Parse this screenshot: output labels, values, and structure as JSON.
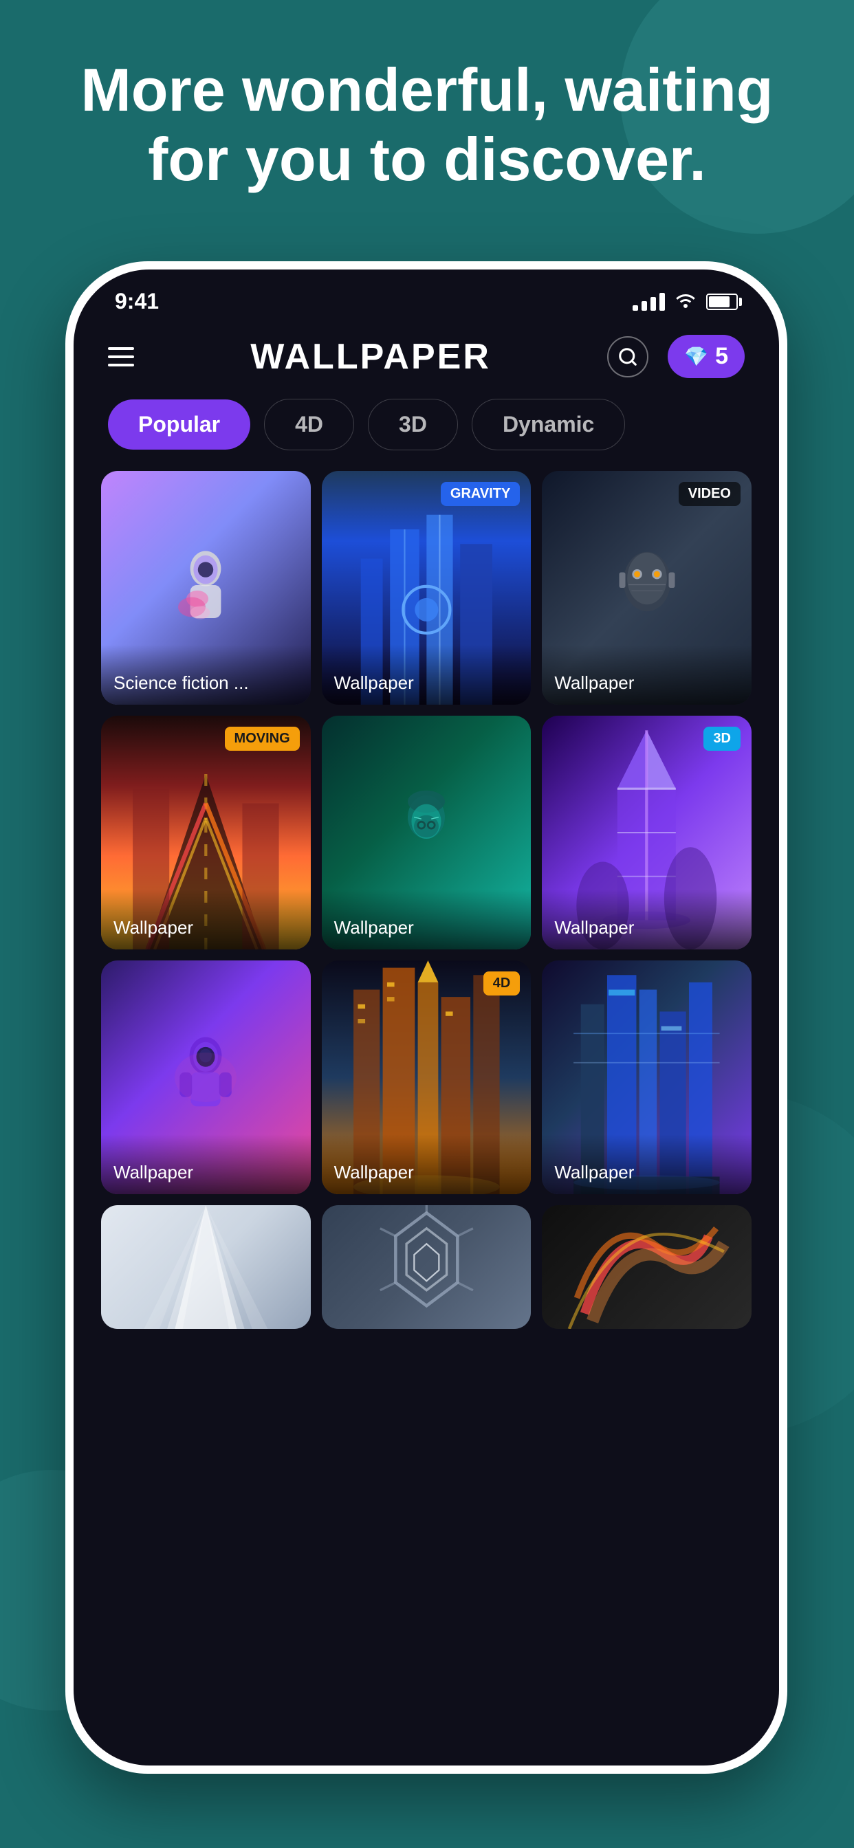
{
  "background": {
    "color": "#1a6b6b"
  },
  "hero": {
    "text": "More wonderful, waiting for you to discover."
  },
  "statusBar": {
    "time": "9:41",
    "signalBars": [
      6,
      10,
      14,
      18
    ],
    "battery": "80"
  },
  "appHeader": {
    "title": "WALLPAPER",
    "searchAriaLabel": "Search",
    "gems": {
      "count": "5",
      "icon": "💎"
    }
  },
  "categories": [
    {
      "label": "Popular",
      "active": true
    },
    {
      "label": "4D",
      "active": false
    },
    {
      "label": "3D",
      "active": false
    },
    {
      "label": "Dynamic",
      "active": false
    }
  ],
  "wallpapers": [
    {
      "label": "Science fiction ...",
      "badge": null,
      "colorClass": "wp-1",
      "hasAstronaut": true
    },
    {
      "label": "Wallpaper",
      "badge": "GRAVITY",
      "badgeClass": "badge-gravity",
      "colorClass": "wp-2"
    },
    {
      "label": "Wallpaper",
      "badge": "VIDEO",
      "badgeClass": "badge-video",
      "colorClass": "wp-3"
    },
    {
      "label": "Wallpaper",
      "badge": "MOVING",
      "badgeClass": "badge-moving",
      "colorClass": "wp-4"
    },
    {
      "label": "Wallpaper",
      "badge": null,
      "colorClass": "wp-5"
    },
    {
      "label": "Wallpaper",
      "badge": "3D",
      "badgeClass": "badge-3d",
      "colorClass": "wp-6"
    },
    {
      "label": "Wallpaper",
      "badge": null,
      "colorClass": "wp-7"
    },
    {
      "label": "Wallpaper",
      "badge": "4D",
      "badgeClass": "badge-4d",
      "colorClass": "wp-8"
    },
    {
      "label": "Wallpaper",
      "badge": null,
      "colorClass": "wp-9"
    }
  ],
  "partialWallpapers": [
    {
      "colorClass": "wp-10",
      "badge": null
    },
    {
      "colorClass": "wp-1",
      "badge": null
    },
    {
      "colorClass": "wp-11",
      "badge": null
    }
  ]
}
